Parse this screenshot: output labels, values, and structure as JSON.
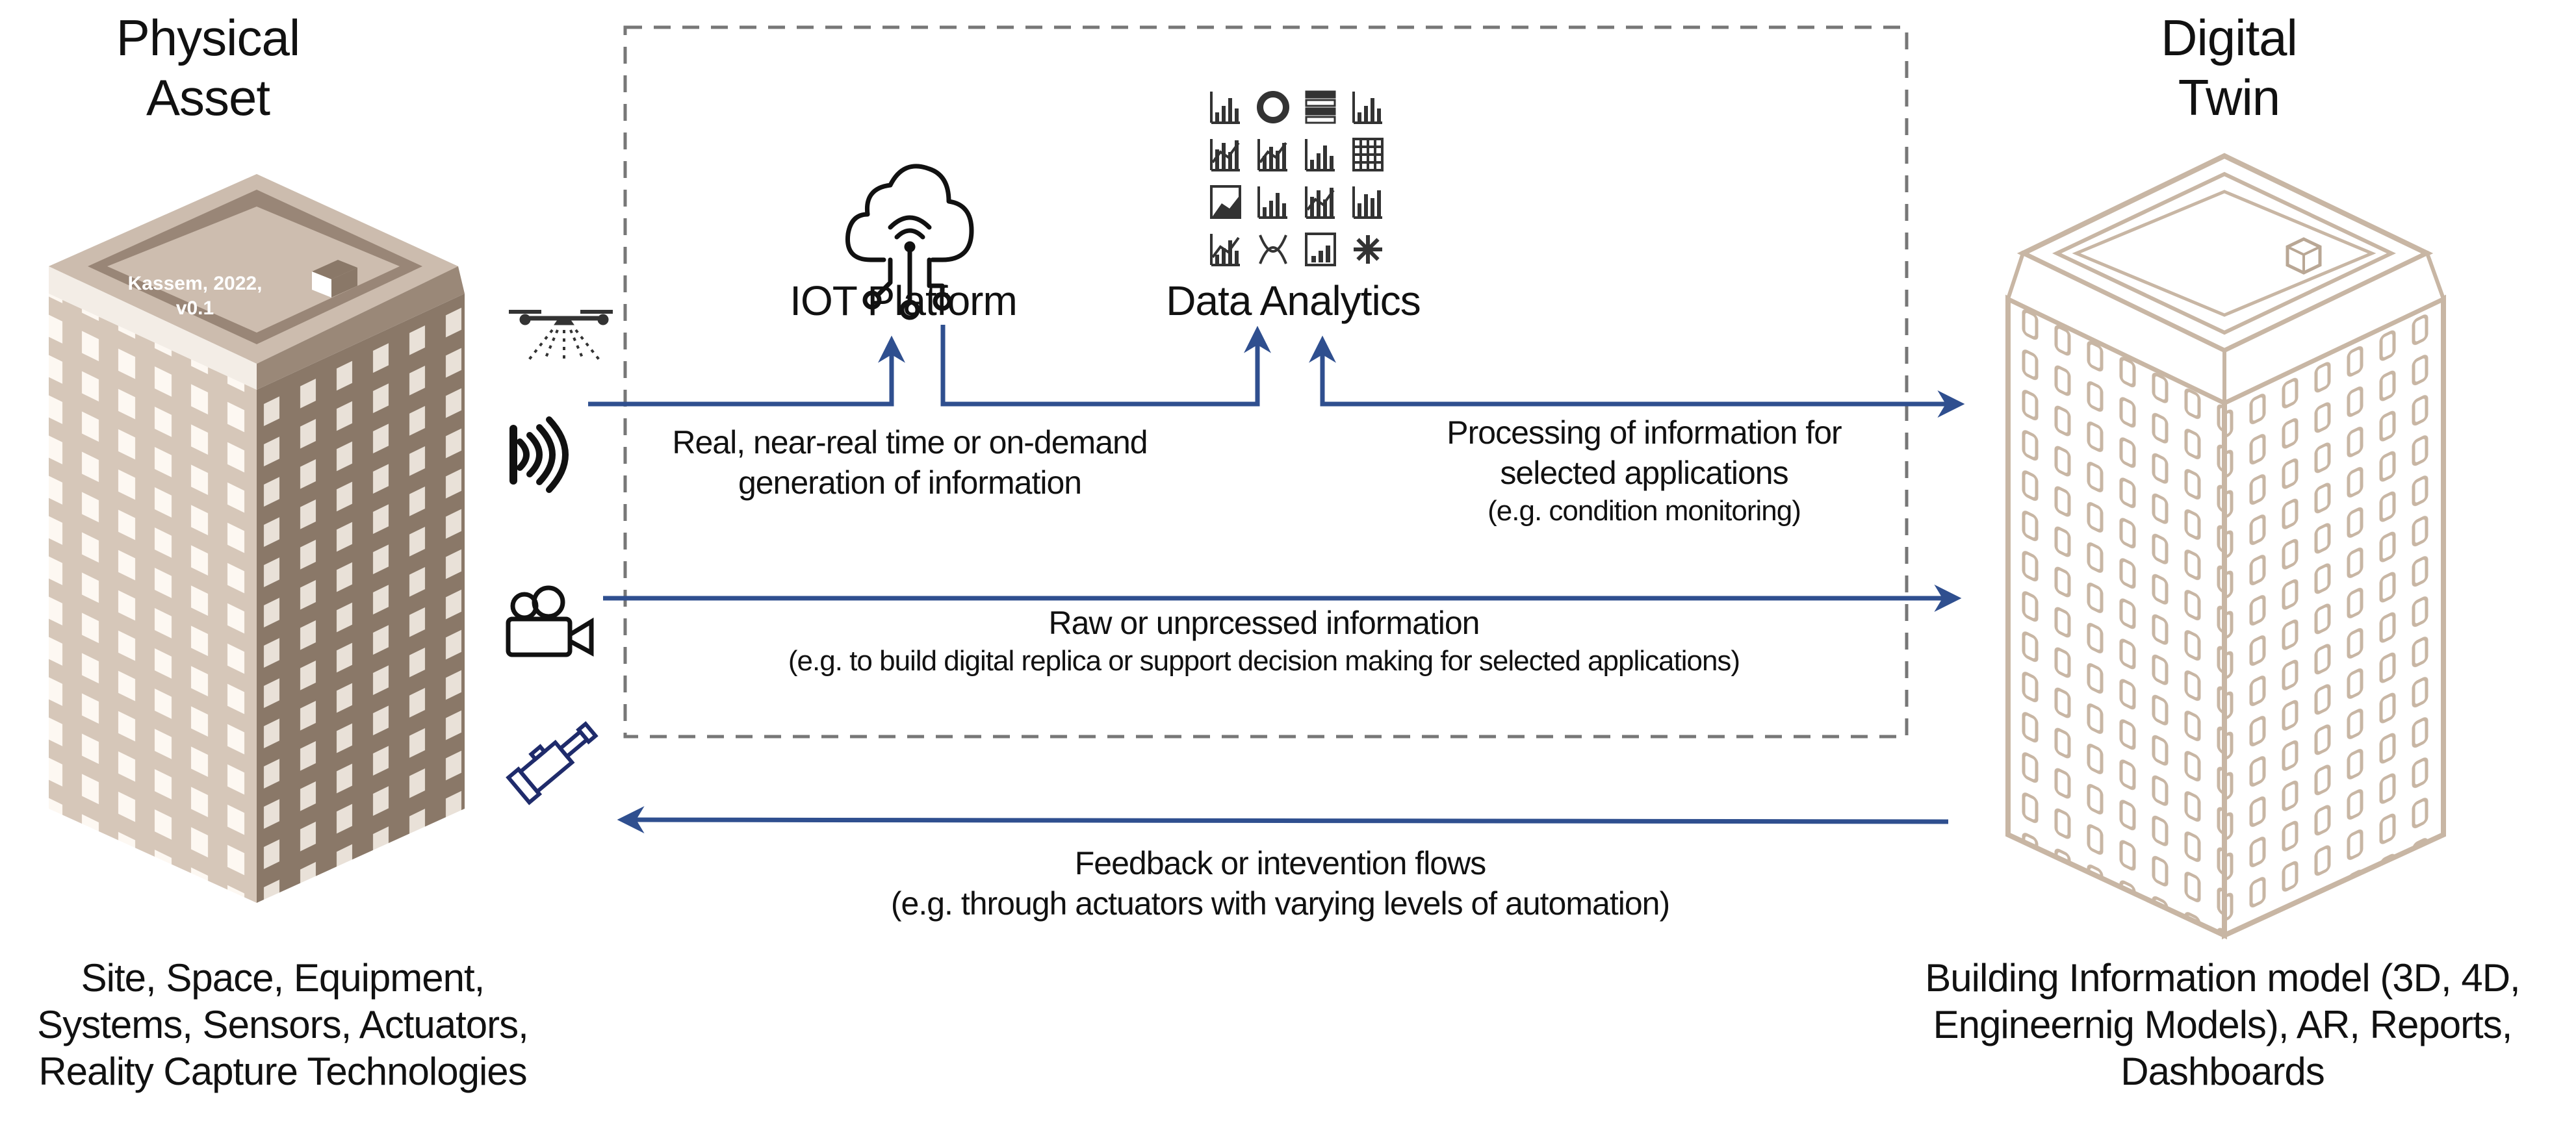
{
  "physical": {
    "title_line1": "Physical",
    "title_line2": "Asset",
    "watermark_line1": "Kassem, 2022,",
    "watermark_line2": "v0.1",
    "caption_lines": [
      "Site, Space, Equipment,",
      "Systems, Sensors, Actuators,",
      "Reality Capture Technologies"
    ]
  },
  "digital": {
    "title_line1": "Digital",
    "title_line2": "Twin",
    "caption_lines": [
      "Building Information model (3D, 4D,",
      "Engineernig Models), AR, Reports,",
      "Dashboards"
    ]
  },
  "nodes": {
    "iot_platform": "IOT Platform",
    "data_analytics": "Data Analytics"
  },
  "sensors": [
    {
      "icon": "drone-icon"
    },
    {
      "icon": "signal-sensor-icon"
    },
    {
      "icon": "video-camera-icon"
    },
    {
      "icon": "actuator-icon"
    }
  ],
  "flows": {
    "realtime": [
      "Real, near-real time or on-demand",
      "generation of information"
    ],
    "processing": [
      "Processing of information for",
      "selected applications",
      "(e.g. condition monitoring)"
    ],
    "raw": [
      "Raw or unprcessed information",
      "(e.g. to build digital replica or support decision making for selected applications)"
    ],
    "feedback": [
      "Feedback or intevention flows",
      "(e.g. through actuators with varying levels of automation)"
    ]
  },
  "colors": {
    "arrow": "#2f4f8f",
    "building_physical_light": "#d6c7b9",
    "building_physical_dark": "#8a7868",
    "building_outline": "#c8b6a4",
    "dashed_box": "#777777"
  }
}
